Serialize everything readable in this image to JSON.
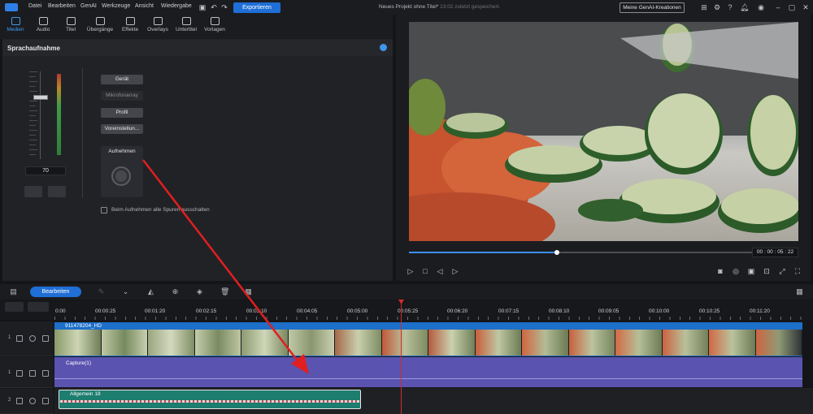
{
  "menu": {
    "items": [
      "Datei",
      "Bearbeiten",
      "GenAI",
      "Werkzeuge",
      "Ansicht",
      "Wiedergabe"
    ],
    "export": "Exportieren",
    "project_title": "Neues Projekt ohne Titel*",
    "project_saved": "13:02 zuletzt gespeichert.",
    "genai_button": "Meine GenAI-Kreationen"
  },
  "tabs": [
    {
      "label": "Medien",
      "active": true,
      "icon": "media-icon"
    },
    {
      "label": "Audio",
      "icon": "music-icon"
    },
    {
      "label": "Titel",
      "icon": "title-icon"
    },
    {
      "label": "Übergänge",
      "icon": "transition-icon"
    },
    {
      "label": "Effekte",
      "icon": "effects-icon"
    },
    {
      "label": "Overlays",
      "icon": "overlay-icon"
    },
    {
      "label": "Untertitel",
      "icon": "subtitle-icon"
    },
    {
      "label": "Vorlagen",
      "icon": "template-icon"
    }
  ],
  "panel": {
    "title": "Sprachaufnahme",
    "volume": "70",
    "buttons": {
      "device": "Gerät",
      "mic": "Mikrofonarray",
      "profile": "Profil",
      "preset": "Voreinstellun..."
    },
    "record": "Aufnehmen",
    "mute_all": "Beim Aufnehmen alle Spuren ausschalten"
  },
  "preview": {
    "timecode": "00 : 00 : 05 : 22",
    "progress": 0.38
  },
  "timeline": {
    "edit": "Bearbeiten",
    "ruler": [
      "0:00",
      "00:00:25",
      "00:01:20",
      "00:02:15",
      "00:03:10",
      "00:04:05",
      "00:05:00",
      "00:05:25",
      "00:06:20",
      "00:07:15",
      "00:08:10",
      "00:09:05",
      "00:10:00",
      "00:10:25",
      "00:11:20"
    ],
    "tracks": [
      {
        "num": "1",
        "clip": "911478204_HD"
      },
      {
        "num": "1",
        "clip": "Capture(1)"
      },
      {
        "num": "2",
        "clip": "Allgemein 18"
      }
    ]
  },
  "colors": {
    "accent": "#1f6fd6",
    "audio_clip": "#5a54b0",
    "video_clip": "#1d6fc9",
    "subtitle_clip": "#1d7d6f",
    "playhead": "#d12b2b",
    "annotation_arrow": "#e01f1f"
  }
}
